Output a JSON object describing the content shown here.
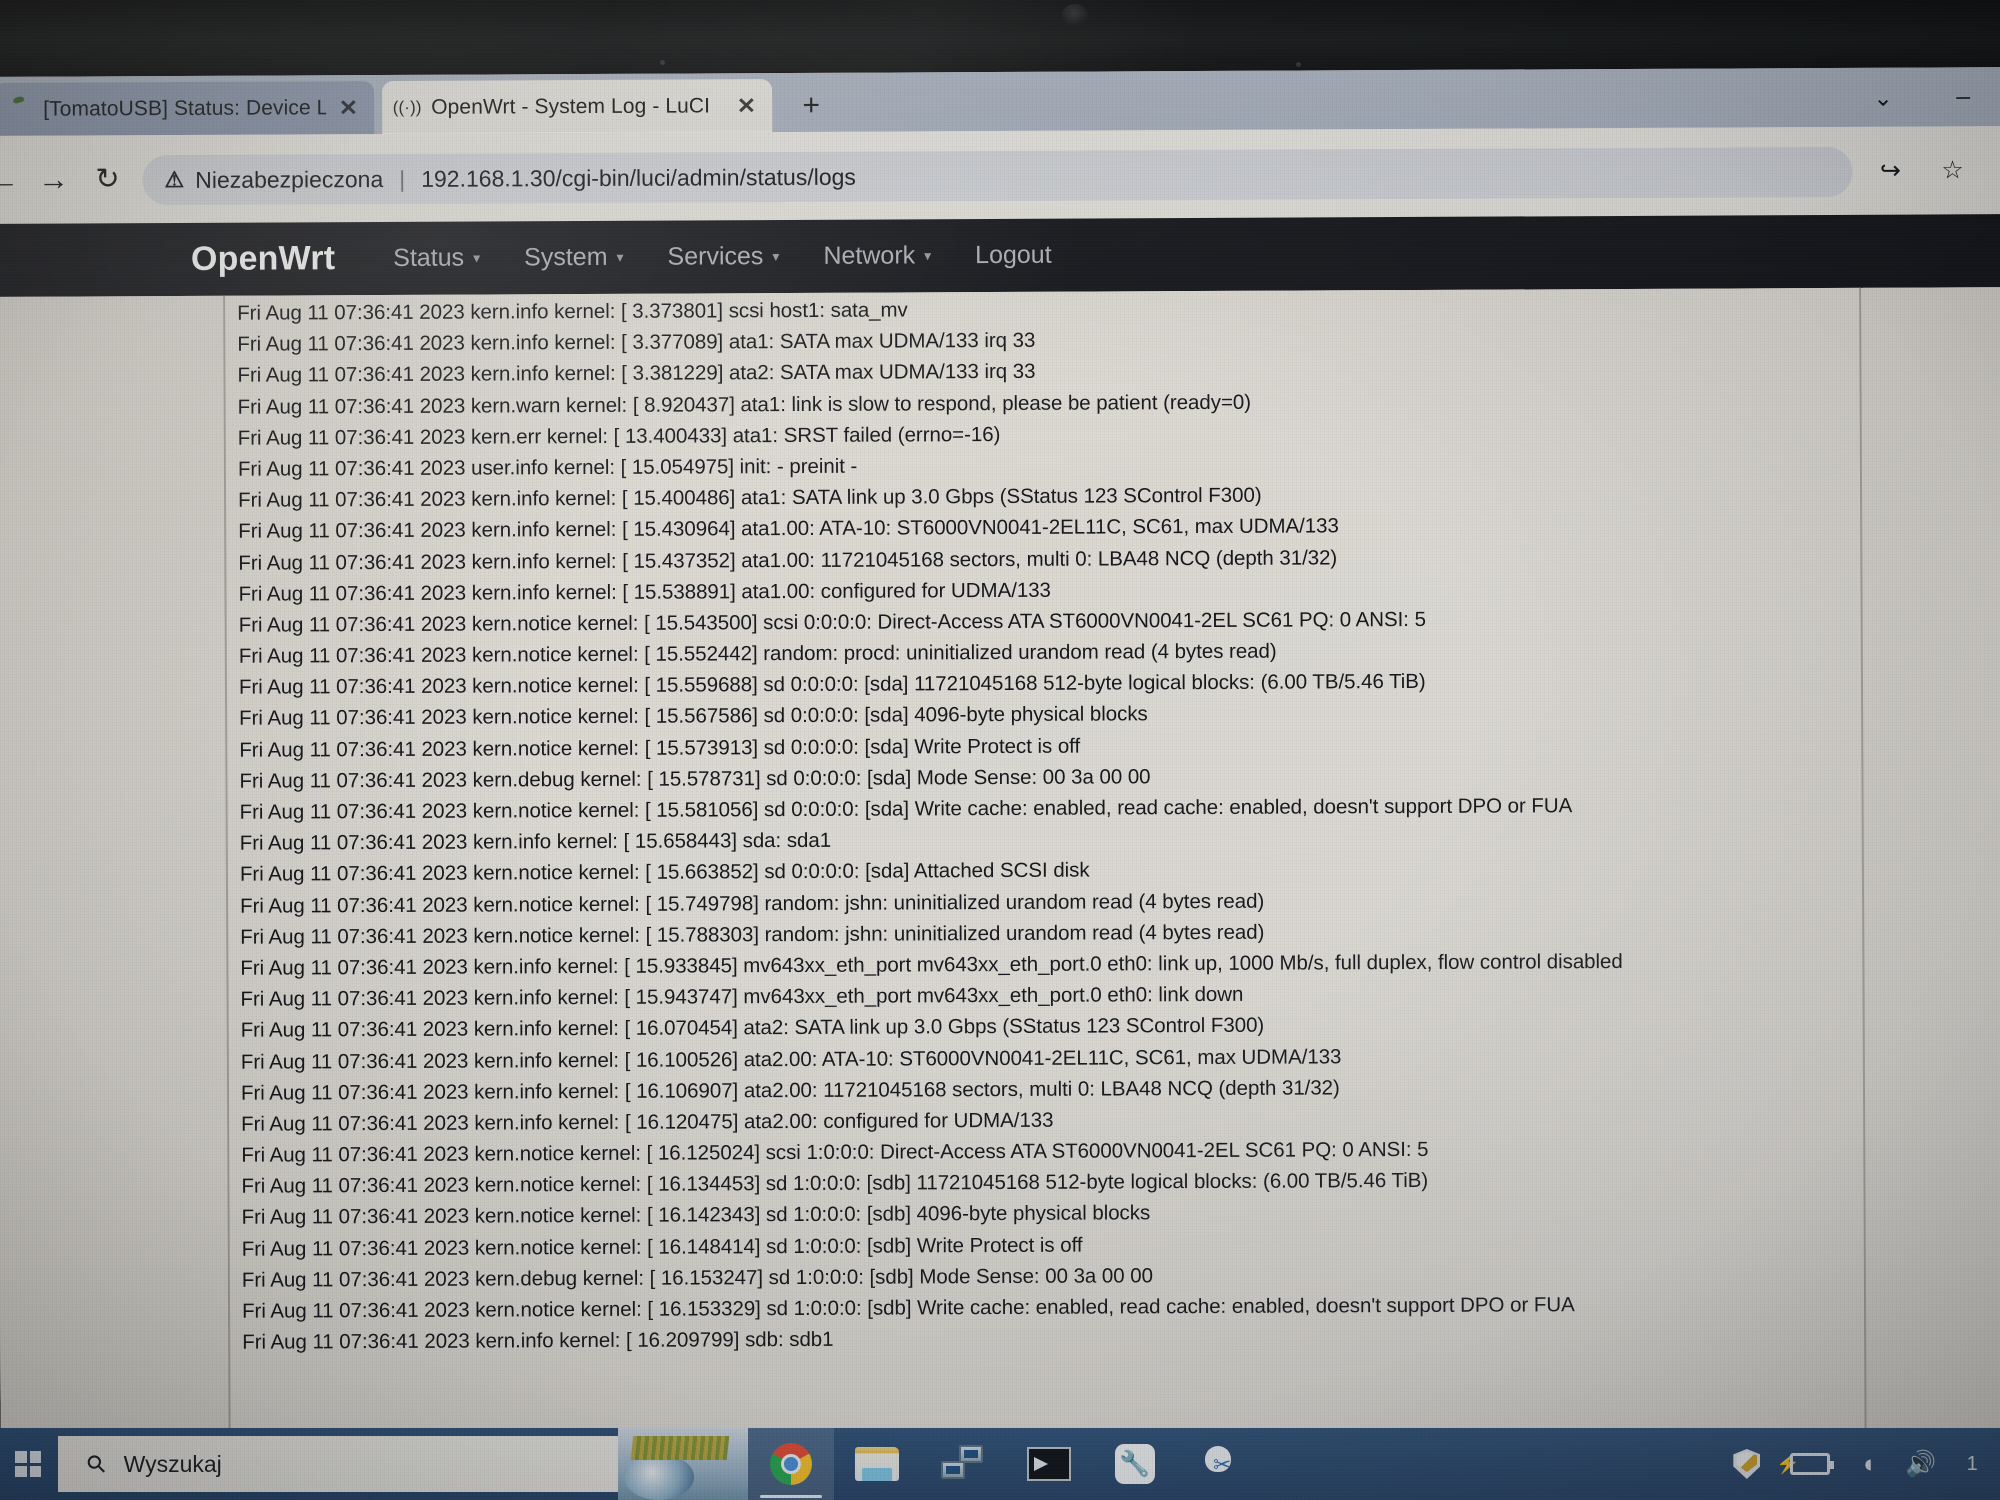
{
  "browser": {
    "tabs": [
      {
        "title": "[TomatoUSB] Status: Device List",
        "favicon": "tomato-icon",
        "close": "✕",
        "active": false
      },
      {
        "title": "OpenWrt - System Log - LuCI",
        "favicon": "wifi-broadcast-icon",
        "close": "✕",
        "active": true
      }
    ],
    "new_tab_label": "+",
    "window_chevron": "⌄",
    "window_minimize": "–",
    "nav": {
      "back": "←",
      "forward": "→",
      "reload": "↻"
    },
    "omnibox": {
      "warning_icon": "⚠",
      "security_label": "Niezabezpieczona",
      "separator": "|",
      "url": "192.168.1.30/cgi-bin/luci/admin/status/logs"
    },
    "actions": {
      "share": "↪",
      "bookmark": "☆"
    }
  },
  "luci": {
    "brand": "OpenWrt",
    "menu": [
      {
        "label": "Status",
        "caret": "▾"
      },
      {
        "label": "System",
        "caret": "▾"
      },
      {
        "label": "Services",
        "caret": "▾"
      },
      {
        "label": "Network",
        "caret": "▾"
      },
      {
        "label": "Logout",
        "caret": ""
      }
    ],
    "log_lines": [
      "Fri Aug 11 07:36:41 2023 kern.info kernel: [    3.373801] scsi host1: sata_mv",
      "Fri Aug 11 07:36:41 2023 kern.info kernel: [    3.377089] ata1: SATA max UDMA/133 irq 33",
      "Fri Aug 11 07:36:41 2023 kern.info kernel: [    3.381229] ata2: SATA max UDMA/133 irq 33",
      "Fri Aug 11 07:36:41 2023 kern.warn kernel: [    8.920437] ata1: link is slow to respond, please be patient (ready=0)",
      "Fri Aug 11 07:36:41 2023 kern.err kernel: [   13.400433] ata1: SRST failed (errno=-16)",
      "Fri Aug 11 07:36:41 2023 user.info kernel: [   15.054975] init: - preinit -",
      "Fri Aug 11 07:36:41 2023 kern.info kernel: [   15.400486] ata1: SATA link up 3.0 Gbps (SStatus 123 SControl F300)",
      "Fri Aug 11 07:36:41 2023 kern.info kernel: [   15.430964] ata1.00: ATA-10: ST6000VN0041-2EL11C, SC61, max UDMA/133",
      "Fri Aug 11 07:36:41 2023 kern.info kernel: [   15.437352] ata1.00: 11721045168 sectors, multi 0: LBA48 NCQ (depth 31/32)",
      "Fri Aug 11 07:36:41 2023 kern.info kernel: [   15.538891] ata1.00: configured for UDMA/133",
      "Fri Aug 11 07:36:41 2023 kern.notice kernel: [   15.543500] scsi 0:0:0:0: Direct-Access     ATA      ST6000VN0041-2EL SC61 PQ: 0 ANSI: 5",
      "Fri Aug 11 07:36:41 2023 kern.notice kernel: [   15.552442] random: procd: uninitialized urandom read (4 bytes read)",
      "Fri Aug 11 07:36:41 2023 kern.notice kernel: [   15.559688] sd 0:0:0:0: [sda] 11721045168 512-byte logical blocks: (6.00 TB/5.46 TiB)",
      "Fri Aug 11 07:36:41 2023 kern.notice kernel: [   15.567586] sd 0:0:0:0: [sda] 4096-byte physical blocks",
      "Fri Aug 11 07:36:41 2023 kern.notice kernel: [   15.573913] sd 0:0:0:0: [sda] Write Protect is off",
      "Fri Aug 11 07:36:41 2023 kern.debug kernel: [   15.578731] sd 0:0:0:0: [sda] Mode Sense: 00 3a 00 00",
      "Fri Aug 11 07:36:41 2023 kern.notice kernel: [   15.581056] sd 0:0:0:0: [sda] Write cache: enabled, read cache: enabled, doesn't support DPO or FUA",
      "Fri Aug 11 07:36:41 2023 kern.info kernel: [   15.658443]  sda: sda1",
      "Fri Aug 11 07:36:41 2023 kern.notice kernel: [   15.663852] sd 0:0:0:0: [sda] Attached SCSI disk",
      "Fri Aug 11 07:36:41 2023 kern.notice kernel: [   15.749798] random: jshn: uninitialized urandom read (4 bytes read)",
      "Fri Aug 11 07:36:41 2023 kern.notice kernel: [   15.788303] random: jshn: uninitialized urandom read (4 bytes read)",
      "Fri Aug 11 07:36:41 2023 kern.info kernel: [   15.933845] mv643xx_eth_port mv643xx_eth_port.0 eth0: link up, 1000 Mb/s, full duplex, flow control disabled",
      "Fri Aug 11 07:36:41 2023 kern.info kernel: [   15.943747] mv643xx_eth_port mv643xx_eth_port.0 eth0: link down",
      "Fri Aug 11 07:36:41 2023 kern.info kernel: [   16.070454] ata2: SATA link up 3.0 Gbps (SStatus 123 SControl F300)",
      "Fri Aug 11 07:36:41 2023 kern.info kernel: [   16.100526] ata2.00: ATA-10: ST6000VN0041-2EL11C, SC61, max UDMA/133",
      "Fri Aug 11 07:36:41 2023 kern.info kernel: [   16.106907] ata2.00: 11721045168 sectors, multi 0: LBA48 NCQ (depth 31/32)",
      "Fri Aug 11 07:36:41 2023 kern.info kernel: [   16.120475] ata2.00: configured for UDMA/133",
      "Fri Aug 11 07:36:41 2023 kern.notice kernel: [   16.125024] scsi 1:0:0:0: Direct-Access     ATA      ST6000VN0041-2EL SC61 PQ: 0 ANSI: 5",
      "Fri Aug 11 07:36:41 2023 kern.notice kernel: [   16.134453] sd 1:0:0:0: [sdb] 11721045168 512-byte logical blocks: (6.00 TB/5.46 TiB)",
      "Fri Aug 11 07:36:41 2023 kern.notice kernel: [   16.142343] sd 1:0:0:0: [sdb] 4096-byte physical blocks",
      "Fri Aug 11 07:36:41 2023 kern.notice kernel: [   16.148414] sd 1:0:0:0: [sdb] Write Protect is off",
      "Fri Aug 11 07:36:41 2023 kern.debug kernel: [   16.153247] sd 1:0:0:0: [sdb] Mode Sense: 00 3a 00 00",
      "Fri Aug 11 07:36:41 2023 kern.notice kernel: [   16.153329] sd 1:0:0:0: [sdb] Write cache: enabled, read cache: enabled, doesn't support DPO or FUA",
      "Fri Aug 11 07:36:41 2023 kern.info kernel: [   16.209799] sdb: sdb1"
    ]
  },
  "taskbar": {
    "start": "windows-logo",
    "search_placeholder": "Wyszukaj",
    "search_icon": "⚲",
    "apps": [
      {
        "name": "chrome-icon",
        "active": true
      },
      {
        "name": "file-explorer-icon",
        "active": false
      },
      {
        "name": "network-transfer-icon",
        "active": false
      },
      {
        "name": "terminal-icon",
        "active": false
      },
      {
        "name": "tools-icon",
        "active": false
      },
      {
        "name": "snipping-tool-icon",
        "active": false
      }
    ],
    "tray": {
      "defender": "shield-icon",
      "battery": "battery-icon",
      "wifi": "wifi-icon",
      "volume": "volume-icon",
      "clock": "1"
    }
  },
  "colors": {
    "luci_nav_bg": "#15171d",
    "log_bg": "#dcd9d3",
    "taskbar_bg": "#2b4a6e",
    "tab_active_bg": "#e9e8e4",
    "tabstrip_bg": "#aeb7c6"
  }
}
